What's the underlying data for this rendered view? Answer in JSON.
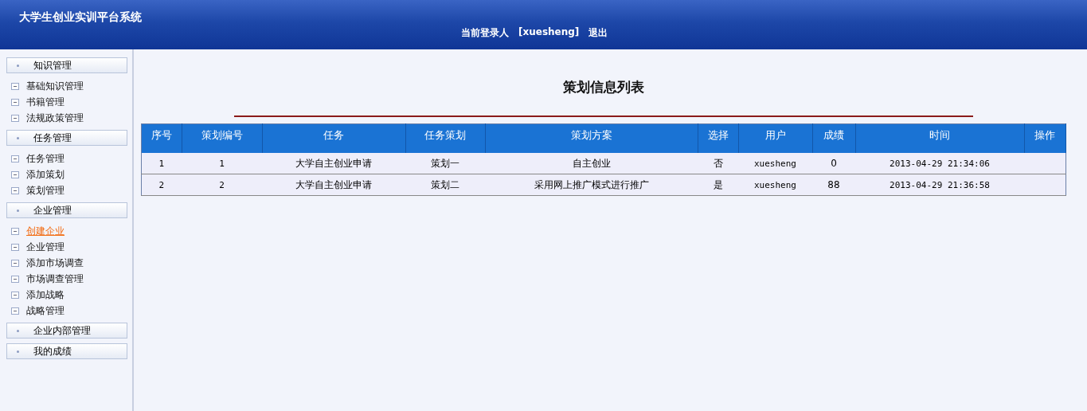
{
  "header": {
    "title": "大学生创业实训平台系统",
    "login_label": "当前登录人",
    "username": "[xuesheng]",
    "logout": "退出"
  },
  "sidebar": {
    "groups": [
      {
        "label": "知识管理",
        "items": [
          {
            "label": "基础知识管理",
            "hovered": false
          },
          {
            "label": "书籍管理",
            "hovered": false
          },
          {
            "label": "法规政策管理",
            "hovered": false
          }
        ]
      },
      {
        "label": "任务管理",
        "items": [
          {
            "label": "任务管理",
            "hovered": false
          },
          {
            "label": "添加策划",
            "hovered": false
          },
          {
            "label": "策划管理",
            "hovered": false
          }
        ]
      },
      {
        "label": "企业管理",
        "items": [
          {
            "label": "创建企业",
            "hovered": true
          },
          {
            "label": "企业管理",
            "hovered": false
          },
          {
            "label": "添加市场调查",
            "hovered": false
          },
          {
            "label": "市场调查管理",
            "hovered": false
          },
          {
            "label": "添加战略",
            "hovered": false
          },
          {
            "label": "战略管理",
            "hovered": false
          }
        ]
      },
      {
        "label": "企业内部管理"
      },
      {
        "label": "我的成绩"
      }
    ]
  },
  "page_title": "策划信息列表",
  "table": {
    "columns": [
      "序号",
      "策划编号",
      "任务",
      "任务策划",
      "策划方案",
      "选择",
      "用户",
      "成绩",
      "时间",
      "操作"
    ],
    "rows": [
      [
        "1",
        "1",
        "大学自主创业申请",
        "策划一",
        "自主创业",
        "否",
        "xuesheng",
        "0",
        "2013-04-29 21:34:06",
        ""
      ],
      [
        "2",
        "2",
        "大学自主创业申请",
        "策划二",
        "采用网上推广模式进行推广",
        "是",
        "xuesheng",
        "88",
        "2013-04-29 21:36:58",
        ""
      ]
    ]
  }
}
